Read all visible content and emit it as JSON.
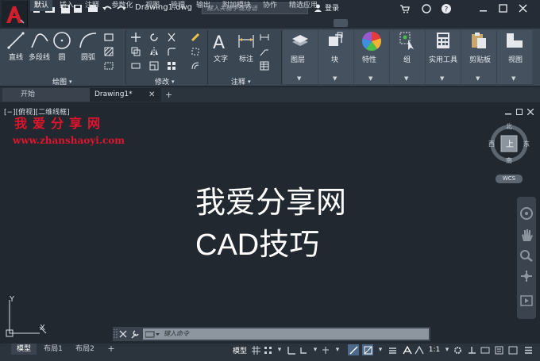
{
  "app": {
    "logo_letter": "A",
    "title": "Drawing1.dwg"
  },
  "search": {
    "placeholder": "键入关键字或短语"
  },
  "user": {
    "login": "登录"
  },
  "ribbon_tabs": [
    "默认",
    "插入",
    "注释",
    "参数化",
    "视图",
    "管理",
    "输出",
    "附加模块",
    "协作",
    "精选应用"
  ],
  "draw_panel": {
    "line": "直线",
    "polyline": "多段线",
    "circle": "圆",
    "arc": "圆弧",
    "label": "绘图"
  },
  "modify_panel": {
    "label": "修改"
  },
  "annotation_panel": {
    "text": "文字",
    "dimension": "标注",
    "label": "注释"
  },
  "tool_buttons": {
    "layers": "图层",
    "block": "块",
    "properties": "特性",
    "groups": "组",
    "utilities": "实用工具",
    "clipboard": "剪贴板",
    "view": "视图"
  },
  "doc_tabs": {
    "start": "开始",
    "drawing": "Drawing1*"
  },
  "viewport": {
    "label": "[−][俯视][二维线框]",
    "watermark_cn": "我爱分享网",
    "watermark_url": "www.zhanshaoyi.com",
    "content_line1": "我爱分享网",
    "content_line2": "CAD技巧"
  },
  "viewcube": {
    "top": "上",
    "north": "北",
    "south": "南",
    "west": "西",
    "east": "东",
    "wcs": "WCS"
  },
  "ucs": {
    "y": "Y",
    "x": "X"
  },
  "command": {
    "placeholder": "键入命令"
  },
  "layout_tabs": [
    "模型",
    "布局1",
    "布局2"
  ],
  "status": {
    "model": "模型",
    "scale": "1:1"
  },
  "colors": {
    "accent_red": "#e0142c",
    "ribbon": "#3b4653",
    "canvas": "#212830"
  }
}
